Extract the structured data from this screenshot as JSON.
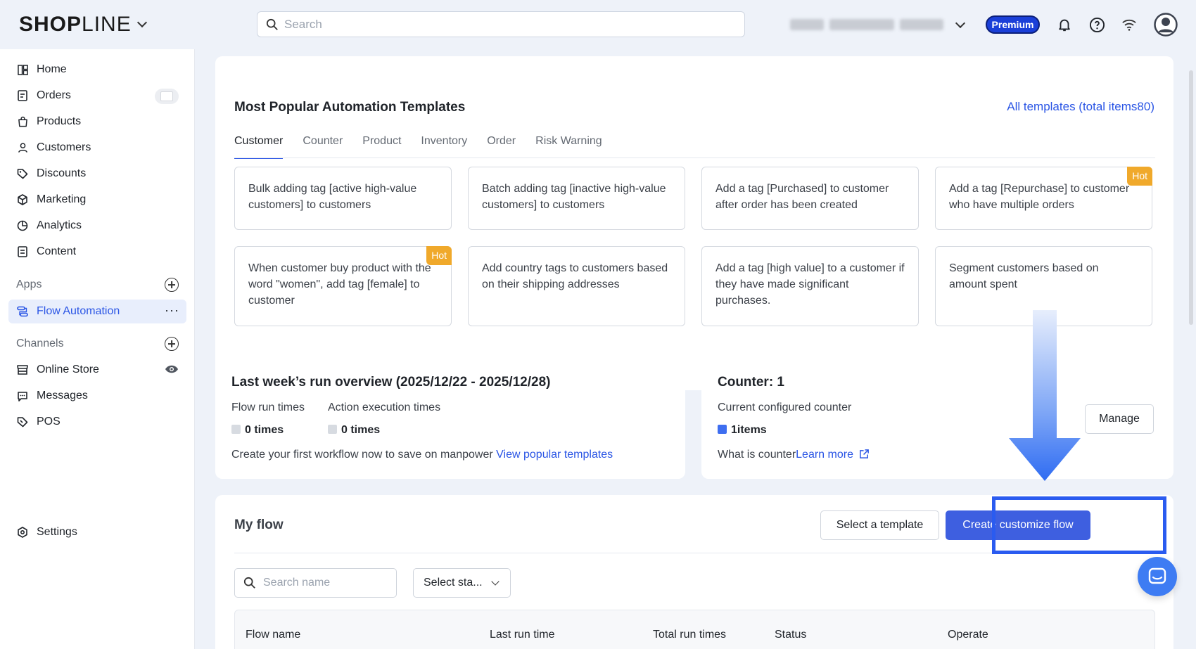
{
  "brand": {
    "logo_bold": "SHOP",
    "logo_light": "LINE"
  },
  "topbar": {
    "search_placeholder": "Search",
    "plan_badge": "Premium"
  },
  "sidebar": {
    "items": [
      {
        "label": "Home",
        "icon": "dashboard-icon"
      },
      {
        "label": "Orders",
        "icon": "orders-icon"
      },
      {
        "label": "Products",
        "icon": "bag-icon"
      },
      {
        "label": "Customers",
        "icon": "person-icon"
      },
      {
        "label": "Discounts",
        "icon": "tag-icon"
      },
      {
        "label": "Marketing",
        "icon": "cube-icon"
      },
      {
        "label": "Analytics",
        "icon": "pie-icon"
      },
      {
        "label": "Content",
        "icon": "document-icon"
      }
    ],
    "apps_label": "Apps",
    "apps": [
      {
        "label": "Flow Automation",
        "icon": "flow-icon",
        "more": "···"
      }
    ],
    "channels_label": "Channels",
    "channels": [
      {
        "label": "Online Store",
        "icon": "store-icon"
      },
      {
        "label": "Messages",
        "icon": "chat-icon"
      },
      {
        "label": "POS",
        "icon": "pos-tag-icon"
      }
    ],
    "settings_label": "Settings"
  },
  "templates": {
    "title": "Most Popular Automation Templates",
    "all_link": "All templates (total items80)",
    "tabs": [
      "Customer",
      "Counter",
      "Product",
      "Inventory",
      "Order",
      "Risk Warning"
    ],
    "active_tab": "Customer",
    "hot_label": "Hot",
    "cards": [
      {
        "text": "Bulk adding tag [active high-value customers] to customers",
        "hot": false
      },
      {
        "text": "Batch adding tag [inactive high-value customers] to customers",
        "hot": false
      },
      {
        "text": "Add a tag [Purchased] to customer after order has been created",
        "hot": false
      },
      {
        "text": "Add a tag [Repurchase] to customer who have multiple orders",
        "hot": true
      },
      {
        "text": "When customer buy product with the word \"women\", add tag [female] to customer",
        "hot": true
      },
      {
        "text": "Add country tags to customers based on their shipping addresses",
        "hot": false
      },
      {
        "text": "Add a tag [high value] to a customer if they have made significant purchases.",
        "hot": false
      },
      {
        "text": "Segment customers based on amount spent",
        "hot": false
      }
    ]
  },
  "overview": {
    "title": "Last week’s run overview (2025/12/22 - 2025/12/28)",
    "flow_run_label": "Flow run times",
    "action_exec_label": "Action execution times",
    "flow_run_value": "0 times",
    "action_exec_value": "0 times",
    "cta_text": "Create your first workflow now to save on manpower ",
    "cta_link": "View popular templates"
  },
  "counter": {
    "title": "Counter: 1",
    "configured_label": "Current configured counter",
    "items_value": "1items",
    "what_is": "What is counter",
    "learn_more": "Learn more",
    "manage_button": "Manage"
  },
  "my_flow": {
    "title": "My flow",
    "select_template_button": "Select a template",
    "create_button": "Create customize flow",
    "search_placeholder": "Search name",
    "status_select": "Select sta...",
    "columns": [
      "Flow name",
      "Last run time",
      "Total run times",
      "Status",
      "Operate"
    ]
  },
  "colors": {
    "accent": "#2a55e5",
    "primary_button": "#3e5fe0",
    "hot_badge": "#f0a92b",
    "premium": "#1a3fd8",
    "highlight": "#2a5bf0"
  }
}
